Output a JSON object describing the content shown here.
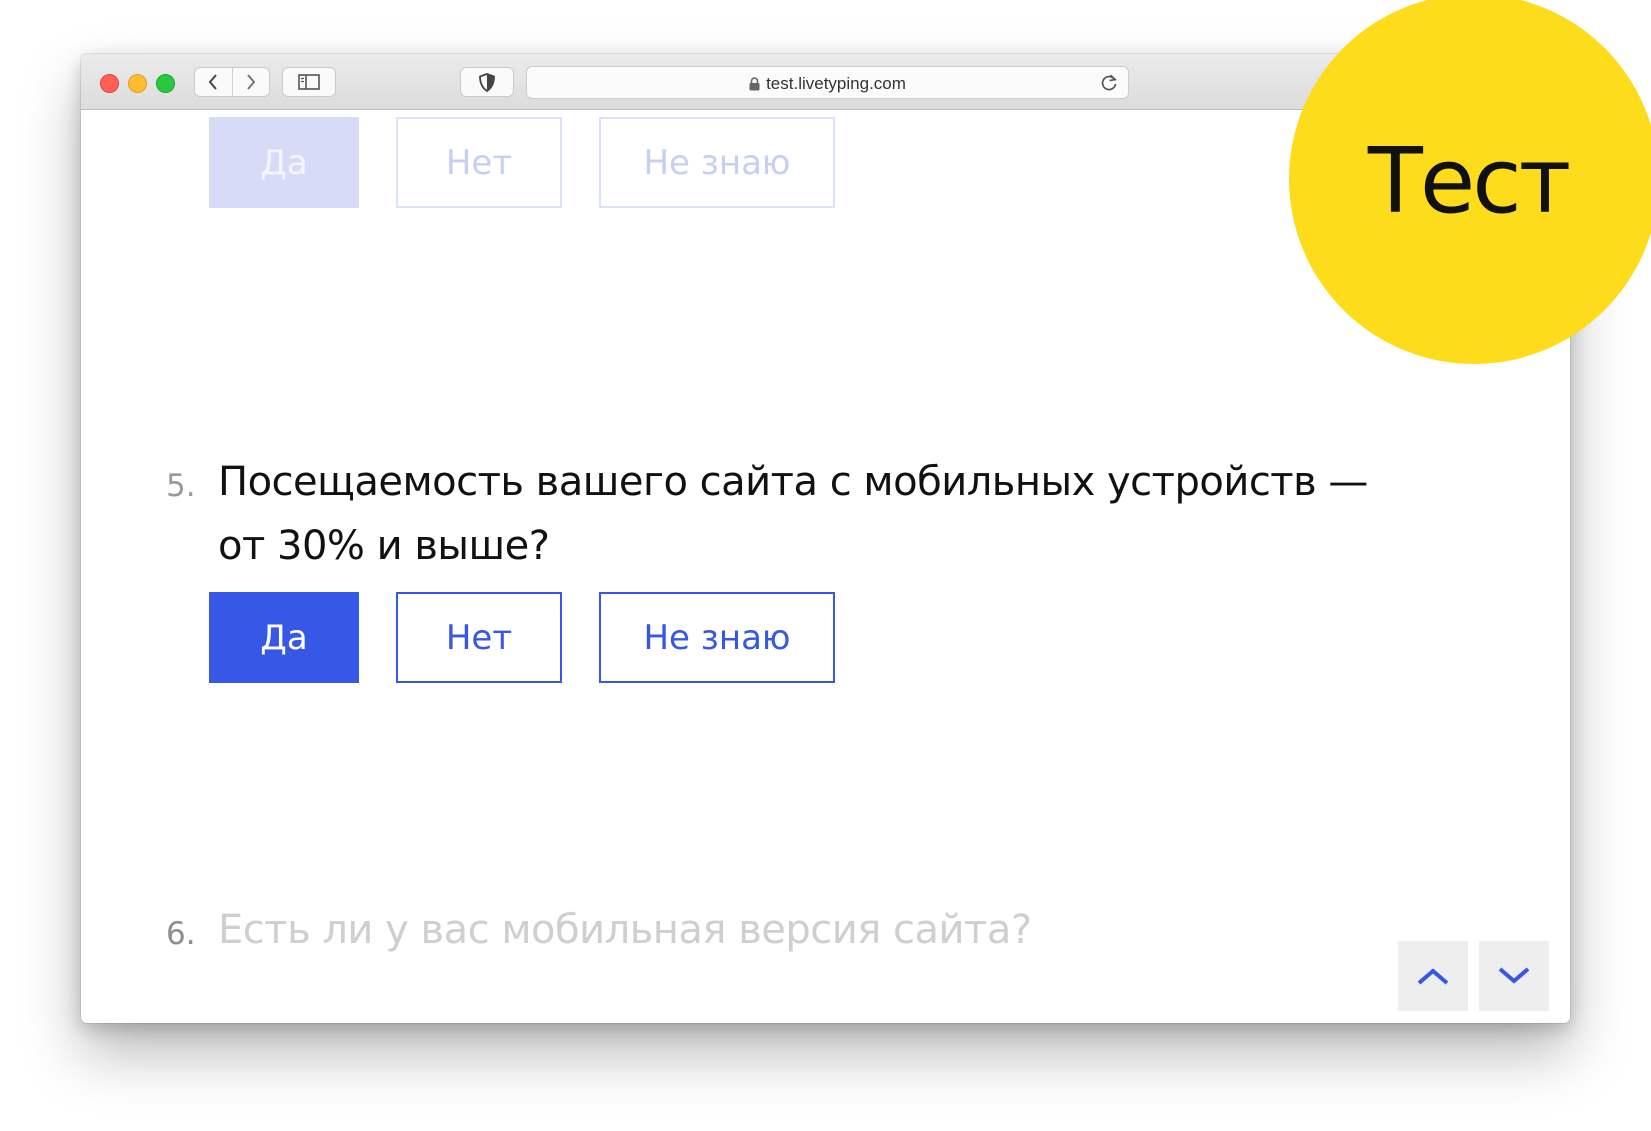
{
  "browser": {
    "url": "test.livetyping.com"
  },
  "previous_question": {
    "answers": [
      {
        "label": "Да",
        "selected": true
      },
      {
        "label": "Нет",
        "selected": false
      },
      {
        "label": "Не знаю",
        "selected": false
      }
    ]
  },
  "current_question": {
    "number": "5.",
    "text_line1": "Посещаемость вашего сайта с мобильных устройств —",
    "text_line2": "от 30% и выше?",
    "answers": [
      {
        "label": "Да",
        "selected": true
      },
      {
        "label": "Нет",
        "selected": false
      },
      {
        "label": "Не знаю",
        "selected": false
      }
    ]
  },
  "next_question": {
    "number": "6.",
    "text": "Есть ли у вас мобильная версия сайта?"
  },
  "navigation": {
    "up_icon": "chevron-up-icon",
    "down_icon": "chevron-down-icon"
  },
  "badge": {
    "label": "Тест"
  },
  "colors": {
    "accent": "#3758e6",
    "accent_faded": "#d6dcf8",
    "badge": "#fddc1c"
  }
}
